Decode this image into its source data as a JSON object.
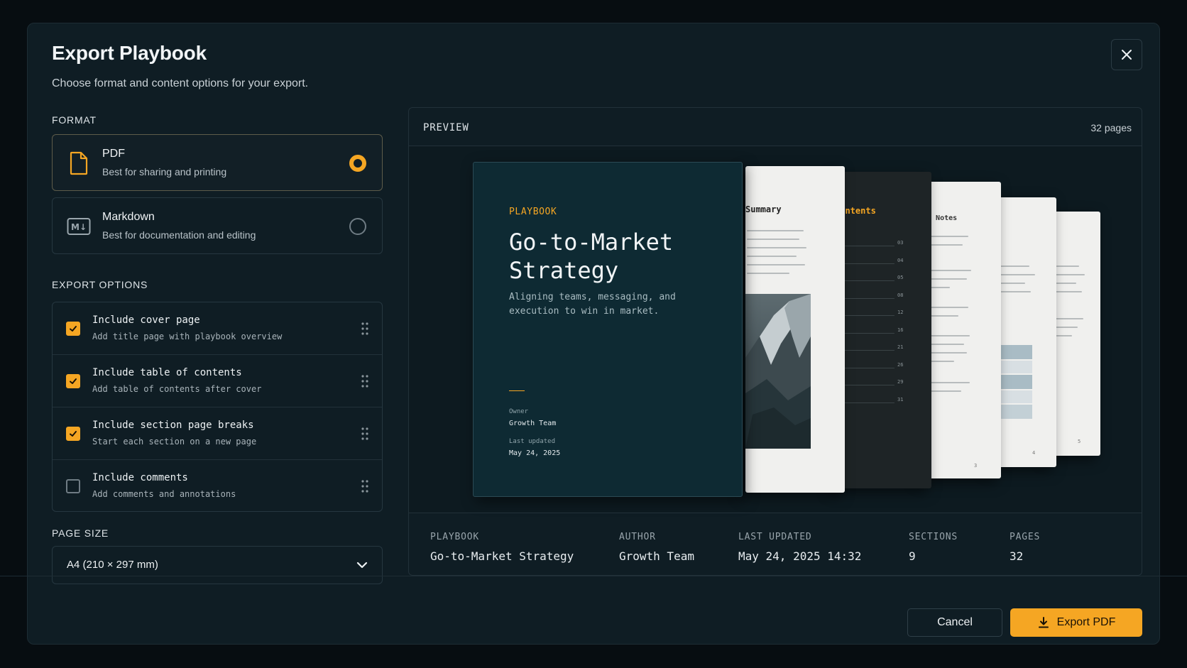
{
  "dialog": {
    "title": "Export Playbook",
    "subtitle": "Choose format and content options for your export."
  },
  "format": {
    "label": "FORMAT",
    "options": [
      {
        "name": "PDF",
        "desc": "Best for sharing and printing",
        "selected": true,
        "icon": "file-icon"
      },
      {
        "name": "Markdown",
        "desc": "Best for documentation and editing",
        "selected": false,
        "icon": "markdown-icon",
        "badge": "M↓"
      }
    ]
  },
  "export_options": {
    "label": "EXPORT OPTIONS",
    "items": [
      {
        "title": "Include cover page",
        "desc": "Add title page with playbook overview",
        "checked": true
      },
      {
        "title": "Include table of contents",
        "desc": "Add table of contents after cover",
        "checked": true
      },
      {
        "title": "Include section page breaks",
        "desc": "Start each section on a new page",
        "checked": true
      },
      {
        "title": "Include comments",
        "desc": "Add comments and annotations",
        "checked": false
      }
    ]
  },
  "page_size": {
    "label": "PAGE SIZE",
    "value": "A4 (210 × 297 mm)"
  },
  "preview": {
    "label": "PREVIEW",
    "pages": "32 pages",
    "cover": {
      "kicker": "PLAYBOOK",
      "title": "Go-to-Market Strategy",
      "subtitle": "Aligning teams, messaging, and execution to win in market.",
      "owner_label": "Owner",
      "owner": "Growth Team",
      "updated_label": "Last updated",
      "updated": "May 24, 2025"
    },
    "page_headings": {
      "summary": "Summary",
      "contents": "Contents",
      "notes": "ne Notes"
    },
    "toc_numbers": [
      "03",
      "04",
      "05",
      "08",
      "12",
      "16",
      "21",
      "26",
      "29",
      "31"
    ],
    "page_numbers": [
      "3",
      "4",
      "5"
    ]
  },
  "meta": [
    {
      "label": "PLAYBOOK",
      "value": "Go-to-Market Strategy"
    },
    {
      "label": "AUTHOR",
      "value": "Growth Team"
    },
    {
      "label": "LAST UPDATED",
      "value": "May 24, 2025 14:32"
    },
    {
      "label": "SECTIONS",
      "value": "9"
    },
    {
      "label": "PAGES",
      "value": "32"
    }
  ],
  "footer": {
    "cancel": "Cancel",
    "export": "Export PDF"
  },
  "colors": {
    "accent": "#f5a623",
    "dialog_bg": "#0f1d24",
    "cover_bg": "#0e2a33"
  }
}
